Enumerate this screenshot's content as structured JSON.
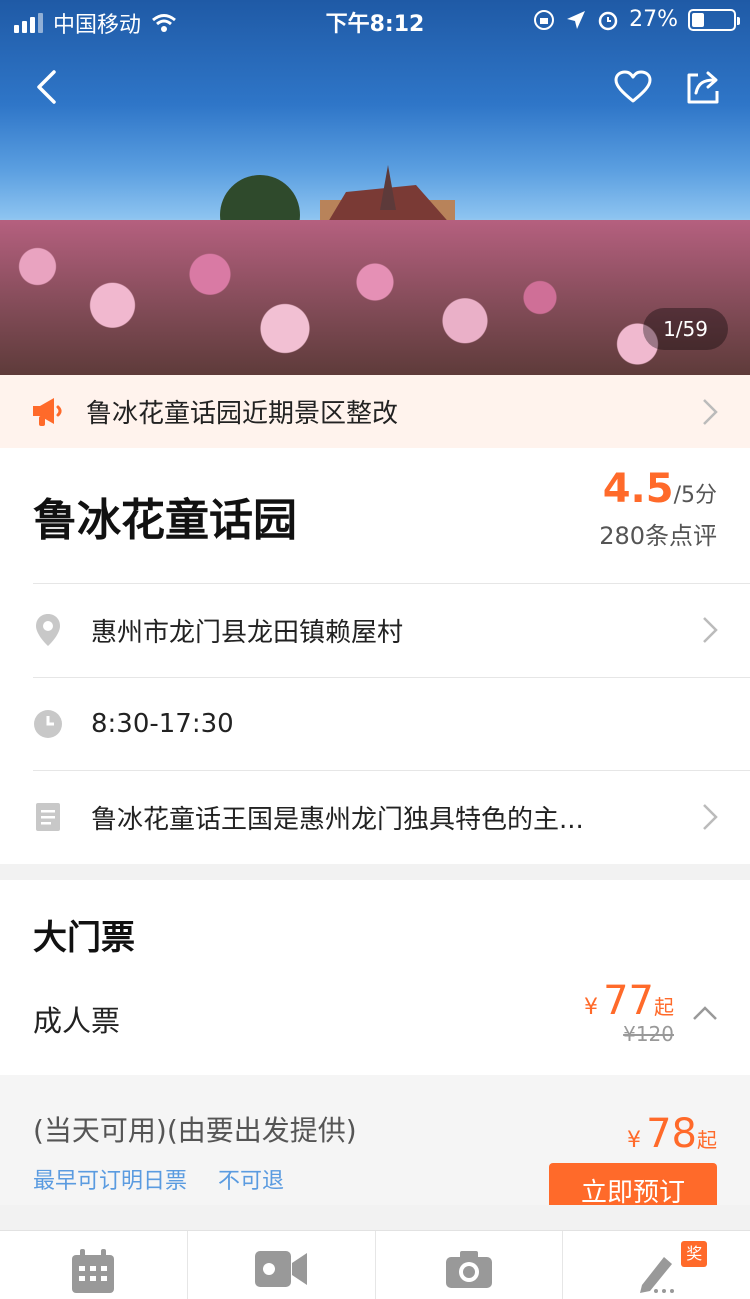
{
  "status": {
    "carrier": "中国移动",
    "time": "下午8:12",
    "battery": "27%"
  },
  "hero": {
    "photo_counter": "1/59",
    "icons": {
      "back": "back-arrow-icon",
      "favorite": "heart-icon",
      "share": "share-icon"
    }
  },
  "notice": {
    "text": "鲁冰花童话园近期景区整改",
    "icon": "megaphone-icon"
  },
  "attraction": {
    "name": "鲁冰花童话园",
    "rating": "4.5",
    "rating_unit": "/5分",
    "review_count": "280条点评",
    "address": "惠州市龙门县龙田镇赖屋村",
    "hours": "8:30-17:30",
    "description": "鲁冰花童话王国是惠州龙门独具特色的主..."
  },
  "tickets": {
    "section_title": "大门票",
    "adult": {
      "label": "成人票",
      "currency": "¥",
      "price": "77",
      "from": "起",
      "original_price": "¥120"
    },
    "option": {
      "desc": "(当天可用)(由要出发提供)",
      "tag1": "最早可订明日票",
      "tag2": "不可退",
      "currency": "¥",
      "price": "78",
      "from": "起",
      "book_label": "立即预订"
    }
  },
  "bottom_tabs": [
    {
      "icon": "calendar-icon"
    },
    {
      "icon": "video-camera-icon"
    },
    {
      "icon": "camera-icon"
    },
    {
      "icon": "pen-icon",
      "badge": "奖"
    }
  ],
  "colors": {
    "accent": "#ff6a2a",
    "link": "#5a9be0",
    "notice_bg": "#fff3ed"
  }
}
